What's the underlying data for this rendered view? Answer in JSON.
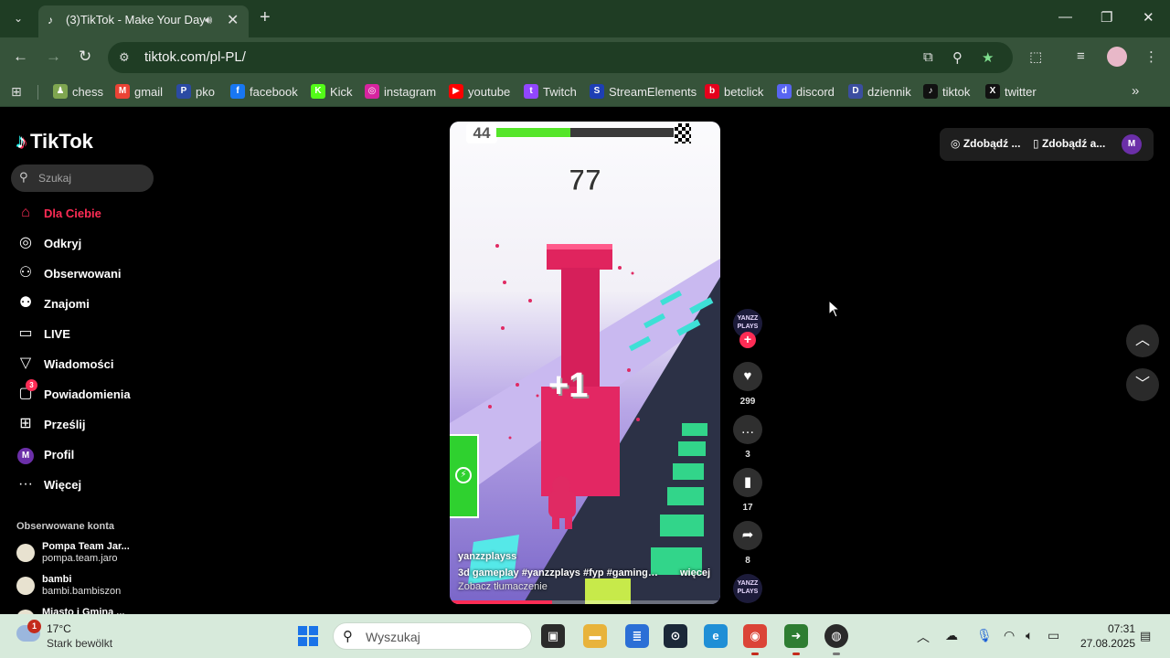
{
  "browser": {
    "tab_title": "(3)TikTok - Make Your Day",
    "url": "tiktok.com/pl-PL/",
    "bookmarks": [
      {
        "label": "chess",
        "icon": "chess-pawn-icon",
        "color": "#7fa650"
      },
      {
        "label": "gmail",
        "icon": "gmail-icon",
        "color": "#ea4335"
      },
      {
        "label": "pko",
        "icon": "pko-icon",
        "color": "#2b4aa3"
      },
      {
        "label": "facebook",
        "icon": "facebook-icon",
        "color": "#1877f2"
      },
      {
        "label": "Kick",
        "icon": "kick-icon",
        "color": "#53fc18"
      },
      {
        "label": "instagram",
        "icon": "instagram-icon",
        "color": "#d6249f"
      },
      {
        "label": "youtube",
        "icon": "youtube-icon",
        "color": "#ff0000"
      },
      {
        "label": "Twitch",
        "icon": "twitch-icon",
        "color": "#9146ff"
      },
      {
        "label": "StreamElements",
        "icon": "streamelements-icon",
        "color": "#1e3fb4"
      },
      {
        "label": "betclick",
        "icon": "betclick-icon",
        "color": "#e5001c"
      },
      {
        "label": "discord",
        "icon": "discord-icon",
        "color": "#5865f2"
      },
      {
        "label": "dziennik",
        "icon": "dziennik-icon",
        "color": "#3b4ea0"
      },
      {
        "label": "tiktok",
        "icon": "tiktok-icon",
        "color": "#111111"
      },
      {
        "label": "twitter",
        "icon": "x-icon",
        "color": "#111111"
      }
    ]
  },
  "tiktok": {
    "logo": "TikTok",
    "search_placeholder": "Szukaj",
    "nav": [
      {
        "label": "Dla Ciebie",
        "icon": "home-icon",
        "active": true
      },
      {
        "label": "Odkryj",
        "icon": "compass-icon"
      },
      {
        "label": "Obserwowani",
        "icon": "following-icon"
      },
      {
        "label": "Znajomi",
        "icon": "friends-icon"
      },
      {
        "label": "LIVE",
        "icon": "live-icon"
      },
      {
        "label": "Wiadomości",
        "icon": "messages-icon"
      },
      {
        "label": "Powiadomienia",
        "icon": "notifications-icon",
        "badge": "3"
      },
      {
        "label": "Prześlij",
        "icon": "upload-icon"
      },
      {
        "label": "Profil",
        "icon": "profile-icon",
        "avatar_letter": "M"
      },
      {
        "label": "Więcej",
        "icon": "more-icon"
      }
    ],
    "following_title": "Obserwowane konta",
    "accounts": [
      {
        "name": "Pompa Team Jar...",
        "handle": "pompa.team.jaro"
      },
      {
        "name": "bambi",
        "handle": "bambi.bambiszon"
      },
      {
        "name": "Miasto i Gmina ...",
        "handle": ""
      }
    ],
    "top_actions": {
      "get_coins": "Zdobądź ...",
      "get_app": "Zdobądź a...",
      "avatar_letter": "M"
    },
    "video": {
      "author": "yanzzplayss",
      "description": "3d gameplay #yanzzplays #fyp #gaming ...",
      "more": "więcej",
      "translate": "Zobacz tłumaczenie",
      "game_level": "44",
      "game_score": "77",
      "game_pickup": "+1",
      "level_progress": 0.42,
      "playback_progress": 0.38,
      "creator_badge": "YANZZ PLAYS"
    },
    "actions": {
      "likes": "299",
      "comments": "3",
      "saves": "17",
      "shares": "8"
    }
  },
  "taskbar": {
    "weather_temp": "17°C",
    "weather_cond": "Stark bewölkt",
    "weather_badge": "1",
    "search_placeholder": "Wyszukaj",
    "time": "07:31",
    "date": "27.08.2025"
  },
  "colors": {
    "tiktok_accent": "#fe2c55",
    "chrome_frame": "#1f3d24",
    "chrome_toolbar": "#36533a"
  }
}
